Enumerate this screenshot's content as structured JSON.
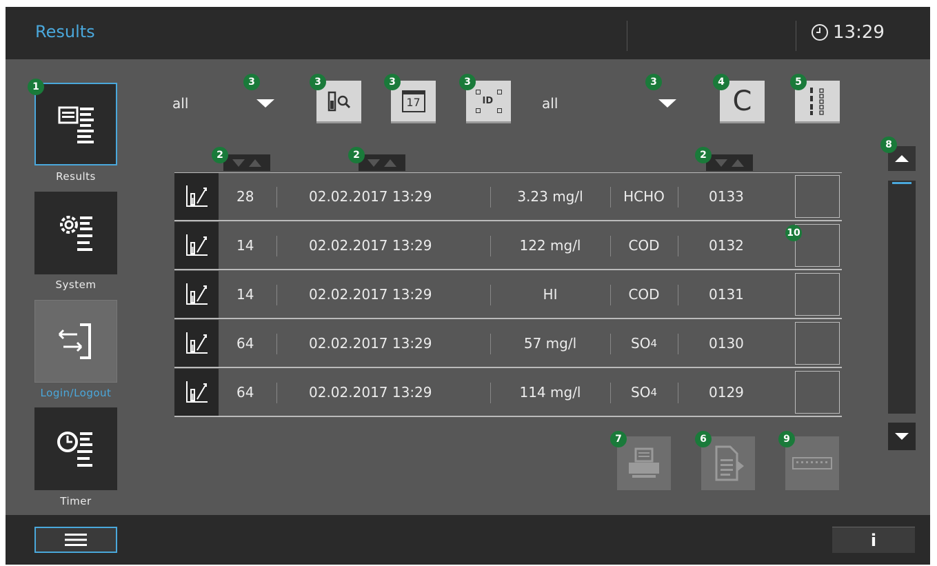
{
  "header": {
    "title": "Results",
    "time": "13:29"
  },
  "sidebar": {
    "items": [
      {
        "label": "Results",
        "active": true,
        "color": "#ececec"
      },
      {
        "label": "System",
        "active": false,
        "color": "#ececec"
      },
      {
        "label": "Login/Logout",
        "active": false,
        "color": "#4aa8dc"
      },
      {
        "label": "Timer",
        "active": false,
        "color": "#ececec"
      }
    ]
  },
  "filters": {
    "left_value": "all",
    "right_value": "all",
    "date_button_text": "17",
    "id_button_text": "ID",
    "clear_button_text": "C"
  },
  "badges": {
    "sidebar_results": "1",
    "filter_dropdown_left": "3",
    "filter_sample": "3",
    "filter_date": "3",
    "filter_id": "3",
    "filter_dropdown_right": "3",
    "clear": "4",
    "column_select": "5",
    "sort_1": "2",
    "sort_2": "2",
    "sort_3": "2",
    "scroll": "8",
    "checkbox": "10",
    "print": "7",
    "export": "6",
    "keyboard": "9"
  },
  "table": {
    "rows": [
      {
        "num": "28",
        "datetime": "02.02.2017 13:29",
        "value": "3.23 mg/l",
        "param": "HCHO",
        "param_sub": "",
        "id": "0133"
      },
      {
        "num": "14",
        "datetime": "02.02.2017 13:29",
        "value": "122 mg/l",
        "param": "COD",
        "param_sub": "",
        "id": "0132"
      },
      {
        "num": "14",
        "datetime": "02.02.2017 13:29",
        "value": "HI",
        "param": "COD",
        "param_sub": "",
        "id": "0131"
      },
      {
        "num": "64",
        "datetime": "02.02.2017 13:29",
        "value": "57 mg/l",
        "param": "SO",
        "param_sub": "4",
        "id": "0130"
      },
      {
        "num": "64",
        "datetime": "02.02.2017 13:29",
        "value": "114 mg/l",
        "param": "SO",
        "param_sub": "4",
        "id": "0129"
      }
    ]
  },
  "footer": {
    "info_label": "i"
  },
  "colors": {
    "accent": "#4aa8dc",
    "badge": "#1a7a3a",
    "header_bg": "#2a2a2a",
    "body_bg": "#575757"
  }
}
